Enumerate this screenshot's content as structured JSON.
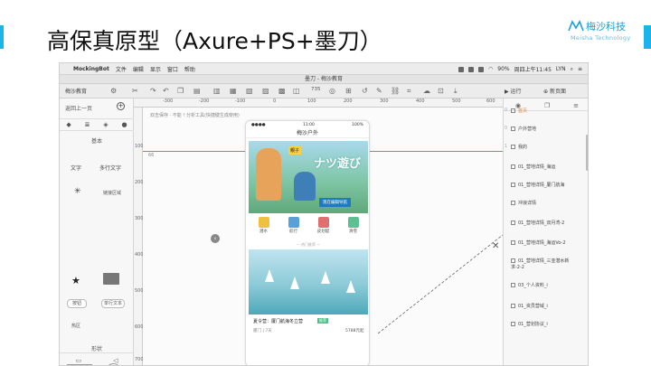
{
  "slide": {
    "title": "高保真原型（Axure+PS+墨刀）",
    "logo_name": "梅沙科技",
    "logo_sub": "Meisha Technology",
    "accent_color": "#19b5e8"
  },
  "menubar": {
    "app": "MockingBot",
    "items": [
      "文件",
      "编辑",
      "显示",
      "窗口",
      "帮助"
    ],
    "battery": "90%",
    "clock": "周四上午11:45",
    "user": "LYN"
  },
  "window": {
    "title": "墨刀 - 梅沙教育",
    "project": "梅沙教育",
    "zoom": "735",
    "run_label": "运行",
    "new_page_label": "新页面"
  },
  "left_panel": {
    "back": "返回上一页",
    "section_basic": "基本",
    "widget_text": "文字",
    "widget_multitext": "多行文字",
    "widget_link": "链接区域",
    "widget_button": "按钮",
    "widget_input": "单行文本",
    "widget_hotspot": "热区",
    "section_shapes": "形状"
  },
  "ruler": {
    "h": [
      "-300",
      "-200",
      "-100",
      "0",
      "100",
      "200",
      "300",
      "400",
      "500",
      "600"
    ],
    "v": [
      "100",
      "200",
      "300",
      "400",
      "500",
      "600",
      "700"
    ]
  },
  "canvas": {
    "hint": "双击保存 · 不能 ! 分析工具(快捷键生成使用)",
    "guide_value": "66"
  },
  "phone": {
    "time": "11:00",
    "battery": "100%",
    "title": "梅沙户外",
    "banner_tag": "親子",
    "banner_big": "ナツ遊び",
    "banner_button": "现在编辑导航",
    "icons": [
      {
        "label": "潜水",
        "color": "#f0c040"
      },
      {
        "label": "航行",
        "color": "#5aa0d8"
      },
      {
        "label": "皮划艇",
        "color": "#e07070"
      },
      {
        "label": "滑雪",
        "color": "#5cc090"
      }
    ],
    "divider": "— 热门推荐 —",
    "card_title": "夏令营：厦门航海冬立营",
    "card_tag": "推荐",
    "card_sub": "厦门 | 7天",
    "card_price": "5788元起"
  },
  "right_panel": {
    "pages": [
      {
        "num": "0",
        "label": "首页",
        "active": true
      },
      {
        "num": "0",
        "label": "户外营地",
        "active": false
      },
      {
        "num": "1",
        "label": "我的",
        "active": false
      },
      {
        "num": "",
        "label": "01_营地详情_海运",
        "active": false
      },
      {
        "num": "",
        "label": "01_营地详情_厦门航海",
        "active": false
      },
      {
        "num": "",
        "label": "冲浪详情",
        "active": false
      },
      {
        "num": "",
        "label": "01_营地详情_双月湾-2",
        "active": false
      },
      {
        "num": "",
        "label": "01_营地详情_海运Vo-2",
        "active": false
      },
      {
        "num": "",
        "label": "01_营地详情_三亚潜水新\n求-2-2",
        "active": false
      },
      {
        "num": "",
        "label": "03_个人资料_i",
        "active": false
      },
      {
        "num": "",
        "label": "01_资员营域_i",
        "active": false
      },
      {
        "num": "",
        "label": "01_营划协议_i",
        "active": false
      }
    ]
  }
}
